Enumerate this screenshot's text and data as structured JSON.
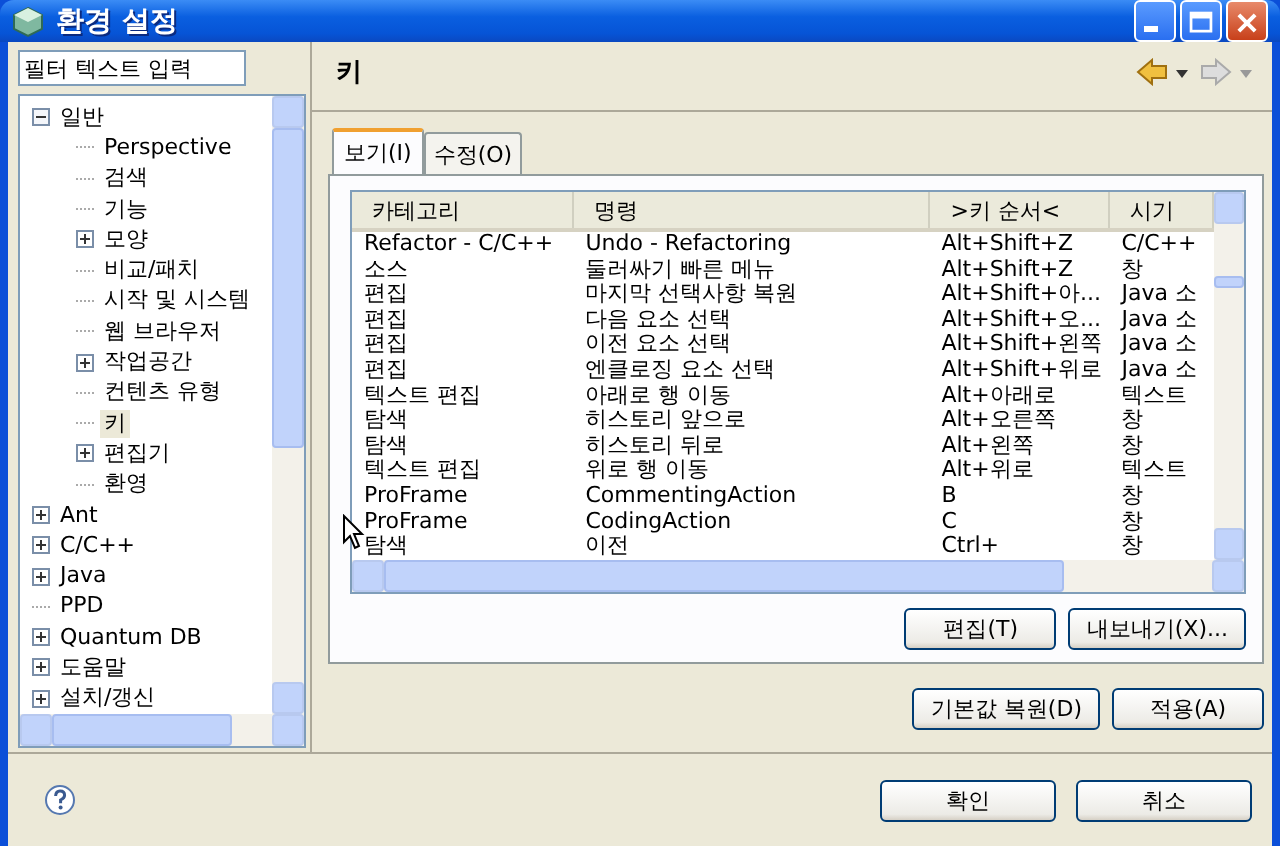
{
  "window": {
    "title": "환경 설정"
  },
  "filter": {
    "placeholder": "필터 텍스트 입력"
  },
  "tree": [
    {
      "label": "일반",
      "kind": "node",
      "expanded": true,
      "selected": false,
      "children": [
        {
          "label": "Perspective",
          "kind": "leaf",
          "selected": false
        },
        {
          "label": "검색",
          "kind": "leaf",
          "selected": false
        },
        {
          "label": "기능",
          "kind": "leaf",
          "selected": false
        },
        {
          "label": "모양",
          "kind": "node",
          "expanded": false,
          "selected": false
        },
        {
          "label": "비교/패치",
          "kind": "leaf",
          "selected": false
        },
        {
          "label": "시작 및 시스템",
          "kind": "leaf",
          "selected": false
        },
        {
          "label": "웹 브라우저",
          "kind": "leaf",
          "selected": false
        },
        {
          "label": "작업공간",
          "kind": "node",
          "expanded": false,
          "selected": false
        },
        {
          "label": "컨텐츠 유형",
          "kind": "leaf",
          "selected": false
        },
        {
          "label": "키",
          "kind": "leaf",
          "selected": true
        },
        {
          "label": "편집기",
          "kind": "node",
          "expanded": false,
          "selected": false
        },
        {
          "label": "환영",
          "kind": "leaf",
          "selected": false
        }
      ]
    },
    {
      "label": "Ant",
      "kind": "node",
      "expanded": false,
      "selected": false
    },
    {
      "label": "C/C++",
      "kind": "node",
      "expanded": false,
      "selected": false
    },
    {
      "label": "Java",
      "kind": "node",
      "expanded": false,
      "selected": false
    },
    {
      "label": "PPD",
      "kind": "leaf",
      "selected": false
    },
    {
      "label": "Quantum DB",
      "kind": "node",
      "expanded": false,
      "selected": false
    },
    {
      "label": "도움말",
      "kind": "node",
      "expanded": false,
      "selected": false
    },
    {
      "label": "설치/갱신",
      "kind": "node",
      "expanded": false,
      "selected": false
    }
  ],
  "page": {
    "title": "키"
  },
  "tabs": [
    {
      "label": "보기(I)",
      "selected": true
    },
    {
      "label": "수정(O)",
      "selected": false
    }
  ],
  "table": {
    "columns": [
      "카테고리",
      "명령",
      ">키 순서<",
      "시기"
    ],
    "rows": [
      [
        "Refactor - C/C++",
        "Undo - Refactoring",
        "Alt+Shift+Z",
        "C/C++"
      ],
      [
        "소스",
        "둘러싸기 빠른 메뉴",
        "Alt+Shift+Z",
        "창"
      ],
      [
        "편집",
        "마지막 선택사항 복원",
        "Alt+Shift+아...",
        "Java 소"
      ],
      [
        "편집",
        "다음 요소 선택",
        "Alt+Shift+오...",
        "Java 소"
      ],
      [
        "편집",
        "이전 요소 선택",
        "Alt+Shift+왼쪽",
        "Java 소"
      ],
      [
        "편집",
        "엔클로징 요소 선택",
        "Alt+Shift+위로",
        "Java 소"
      ],
      [
        "텍스트 편집",
        "아래로 행 이동",
        "Alt+아래로",
        "텍스트"
      ],
      [
        "탐색",
        "히스토리 앞으로",
        "Alt+오른쪽",
        "창"
      ],
      [
        "탐색",
        "히스토리 뒤로",
        "Alt+왼쪽",
        "창"
      ],
      [
        "텍스트 편집",
        "위로 행 이동",
        "Alt+위로",
        "텍스트"
      ],
      [
        "ProFrame",
        "CommentingAction",
        "B",
        "창"
      ],
      [
        "ProFrame",
        "CodingAction",
        "C",
        "창"
      ],
      [
        "탐색",
        "이전",
        "Ctrl+",
        "창"
      ]
    ]
  },
  "table_buttons": [
    "편집(T)",
    "내보내기(X)..."
  ],
  "page_buttons": [
    "기본값 복원(D)",
    "적용(A)"
  ],
  "dialog_buttons": [
    "확인",
    "취소"
  ]
}
